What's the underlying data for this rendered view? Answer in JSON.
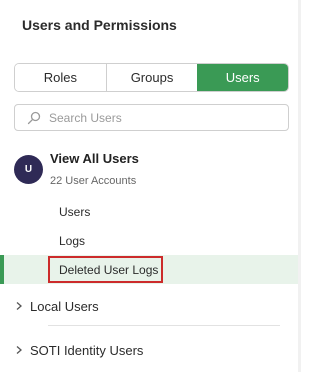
{
  "panel": {
    "title": "Users and Permissions",
    "tabs": [
      {
        "label": "Roles",
        "active": false
      },
      {
        "label": "Groups",
        "active": false
      },
      {
        "label": "Users",
        "active": true
      }
    ],
    "search": {
      "placeholder": "Search Users",
      "value": "",
      "icon": "search-icon"
    },
    "group": {
      "avatar_letter": "U",
      "title": "View All Users",
      "subtitle": "22 User Accounts",
      "items": [
        {
          "label": "Users"
        },
        {
          "label": "Logs"
        },
        {
          "label": "Deleted User Logs",
          "selected": true
        }
      ]
    },
    "sections": [
      {
        "label": "Local Users",
        "icon": "chevron-right-icon"
      },
      {
        "label": "SOTI Identity Users",
        "icon": "chevron-right-icon"
      }
    ],
    "colors": {
      "accent": "#3a9a55",
      "avatar": "#2f2a56",
      "highlight": "#cc2b2b",
      "selected_bg": "#e8f3ea"
    }
  }
}
